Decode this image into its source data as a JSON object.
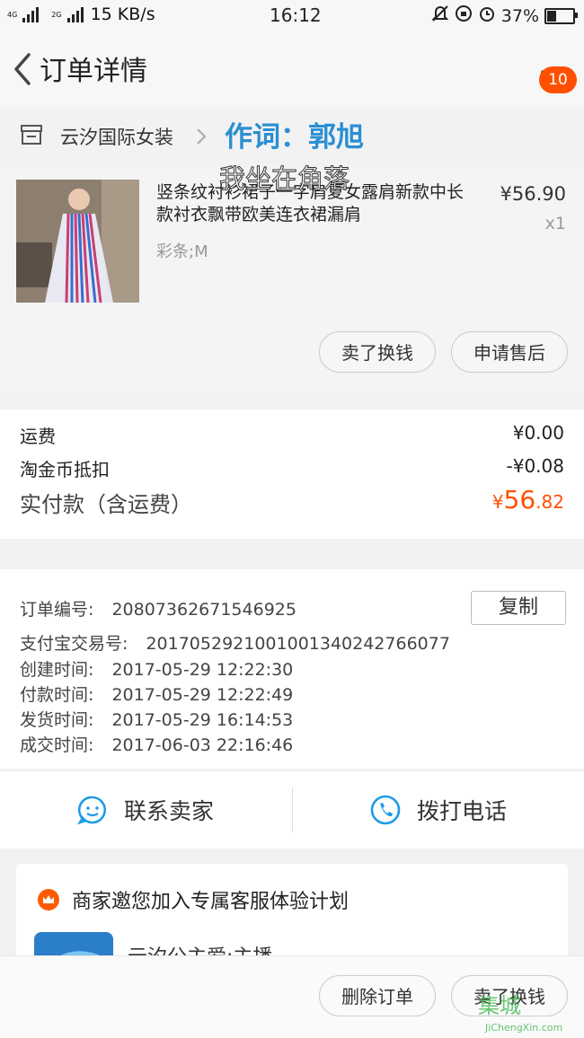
{
  "status_bar": {
    "speed": "15 KB/s",
    "time": "16:12",
    "battery": "37%",
    "battery_level": 0.37,
    "net1": "4G",
    "net2": "2G"
  },
  "header": {
    "title": "订单详情",
    "badge": "10"
  },
  "shop": {
    "name": "云汐国际女装"
  },
  "overlay": {
    "line1": "作词：郭旭",
    "line2": "我坐在角落"
  },
  "product": {
    "title": "竖条纹衬衫裙子一字肩夏女露肩新款中长款衬衣飘带欧美连衣裙漏肩",
    "sku": "彩条;M",
    "price": "¥56.90",
    "qty": "x1",
    "btn_sell": "卖了换钱",
    "btn_after_sale": "申请售后"
  },
  "fees": {
    "shipping_label": "运费",
    "shipping_value": "¥0.00",
    "coin_label": "淘金币抵扣",
    "coin_value": "-¥0.08",
    "paid_label": "实付款（含运费）",
    "paid_currency": "¥",
    "paid_integer": "56",
    "paid_decimal": ".82"
  },
  "order_info": {
    "order_no_label": "订单编号:",
    "order_no": "20807362671546925",
    "copy_label": "复制",
    "alipay_label": "支付宝交易号:",
    "alipay_no": "2017052921001001340242766077",
    "created_label": "创建时间:",
    "created": "2017-05-29 12:22:30",
    "paid_label": "付款时间:",
    "paid": "2017-05-29 12:22:49",
    "shipped_label": "发货时间:",
    "shipped": "2017-05-29 16:14:53",
    "done_label": "成交时间:",
    "done": "2017-06-03 22:16:46"
  },
  "contact": {
    "seller_label": "联系卖家",
    "call_label": "拨打电话"
  },
  "promo": {
    "title": "商家邀您加入专属客服体验计划",
    "subtitle": "云汐公主爱:主播"
  },
  "footer": {
    "delete_label": "删除订单",
    "sell_label": "卖了换钱"
  },
  "watermark": {
    "text": "集城",
    "sub": "JiChengXin.com"
  },
  "colors": {
    "accent": "#ff5000",
    "link_blue": "#2a8fd3",
    "icon_blue": "#1e9be6"
  }
}
